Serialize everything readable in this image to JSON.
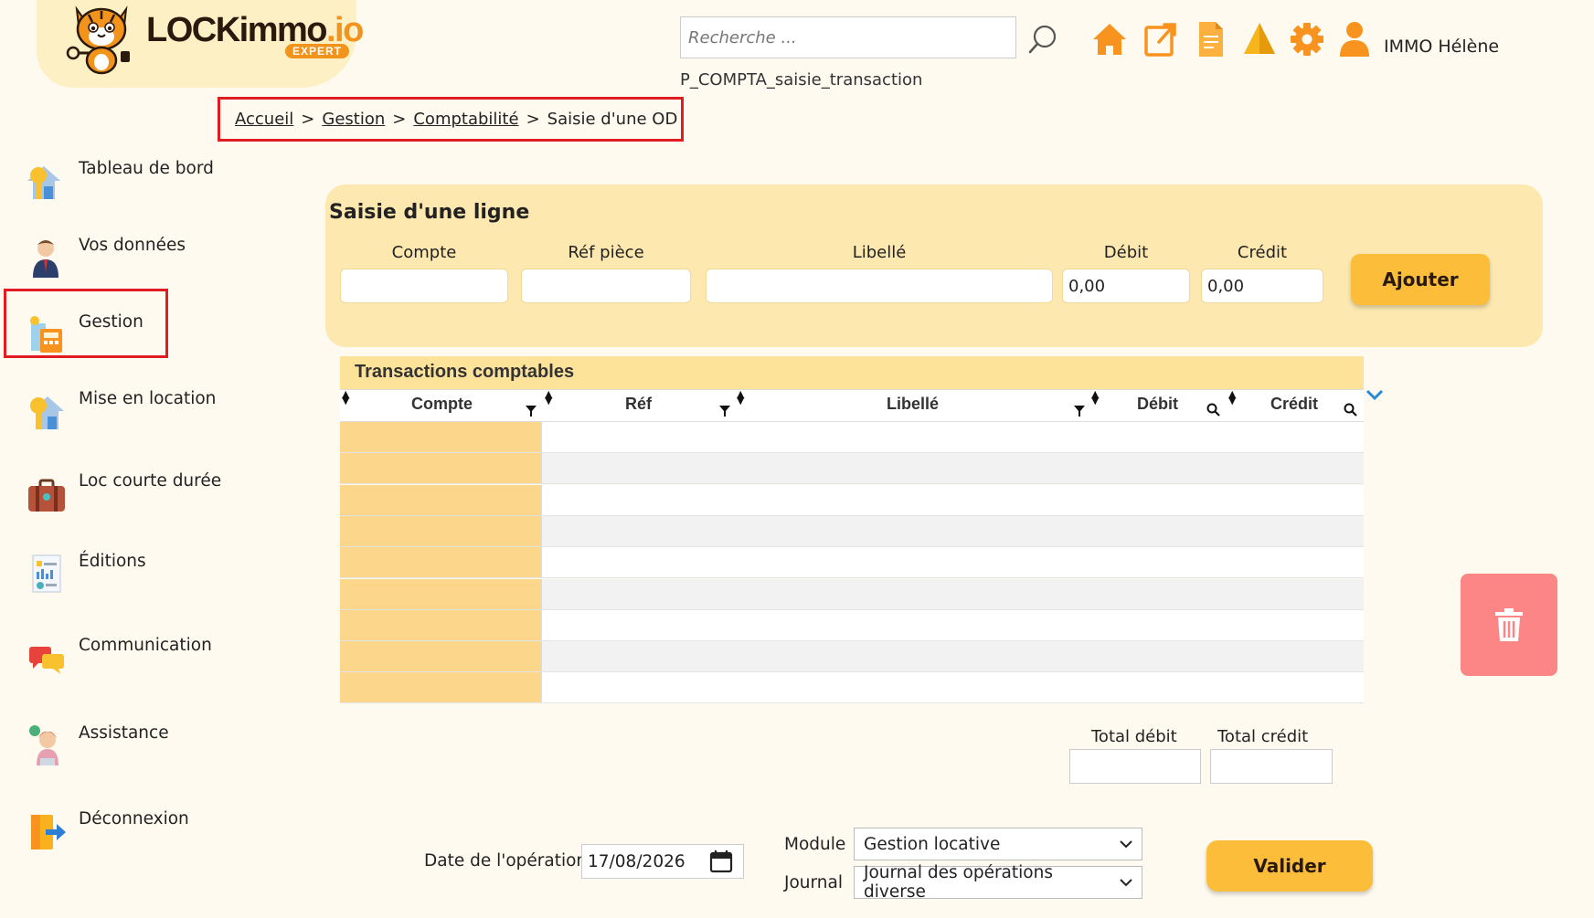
{
  "logo": {
    "text_main": "LOCKimmo",
    "text_suffix": ".io",
    "badge": "EXPERT"
  },
  "header": {
    "search_placeholder": "Recherche ...",
    "user_name": "IMMO Hélène",
    "page_code": "P_COMPTA_saisie_transaction",
    "icons": [
      "home-icon",
      "external-link-icon",
      "document-icon",
      "alert-icon",
      "gear-icon",
      "user-icon"
    ]
  },
  "breadcrumb": {
    "items": [
      "Accueil",
      "Gestion",
      "Comptabilité"
    ],
    "current": "Saisie d'une OD",
    "separator": ">"
  },
  "sidebar": {
    "items": [
      {
        "label": "Tableau de bord",
        "icon": "dashboard-icon"
      },
      {
        "label": "Vos données",
        "icon": "person-icon"
      },
      {
        "label": "Gestion",
        "icon": "management-icon"
      },
      {
        "label": "Mise en location",
        "icon": "rental-icon"
      },
      {
        "label": "Loc courte durée",
        "icon": "suitcase-icon"
      },
      {
        "label": "Éditions",
        "icon": "report-icon"
      },
      {
        "label": "Communication",
        "icon": "chat-icon"
      },
      {
        "label": "Assistance",
        "icon": "support-icon"
      },
      {
        "label": "Déconnexion",
        "icon": "logout-icon"
      }
    ],
    "highlighted": "Gestion"
  },
  "saisie": {
    "title": "Saisie d'une ligne",
    "labels": {
      "compte": "Compte",
      "ref": "Réf pièce",
      "libelle": "Libellé",
      "debit": "Débit",
      "credit": "Crédit"
    },
    "values": {
      "compte": "",
      "ref": "",
      "libelle": "",
      "debit": "0,00",
      "credit": "0,00"
    },
    "add_button": "Ajouter"
  },
  "transactions": {
    "title": "Transactions comptables",
    "columns": [
      "Compte",
      "Réf",
      "Libellé",
      "Débit",
      "Crédit"
    ],
    "row_count": 9
  },
  "totals": {
    "debit_label": "Total débit",
    "credit_label": "Total crédit",
    "debit_value": "",
    "credit_value": ""
  },
  "footer_form": {
    "date_label": "Date de l'opération",
    "date_value": "17/08/2026",
    "module_label": "Module",
    "module_value": "Gestion locative",
    "journal_label": "Journal",
    "journal_value": "Journal des opérations diverse",
    "submit_button": "Valider"
  },
  "colors": {
    "background": "#fffaef",
    "panel": "#fde8b0",
    "accent": "#fbbd3a",
    "highlight_border": "#e01b22",
    "delete": "#fc8685",
    "icon_orange": "#f7931e"
  }
}
